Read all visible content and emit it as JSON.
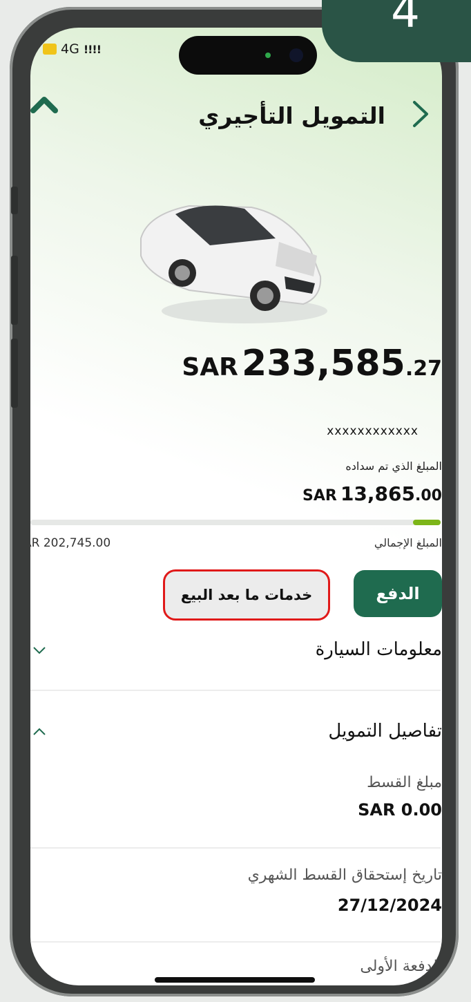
{
  "status_bar": {
    "network": "4G",
    "signal": "!!!!"
  },
  "corner_badge": {
    "step": "4"
  },
  "header": {
    "title": "التمويل التأجيري"
  },
  "finance": {
    "total_currency": "SAR",
    "total_integer": "233,585",
    "total_decimal": ".27",
    "account_number": "xxxxxxxxxxxx",
    "paid_label": "المبلغ الذي تم سداده",
    "paid_currency": "SAR",
    "paid_integer": "13,865",
    "paid_decimal": ".00",
    "progress_fraction": 0.068,
    "total_label": "المبلغ الإجمالي",
    "total_amount": "AR 202,745.00"
  },
  "actions": {
    "pay_label": "الدفع",
    "after_sales_label": "خدمات ما بعد البيع"
  },
  "sections": {
    "car_info": {
      "title": "معلومات السيارة"
    },
    "finance_details": {
      "title": "تفاصيل التمويل"
    }
  },
  "details": [
    {
      "label": "مبلغ القسط",
      "value": "SAR 0.00"
    },
    {
      "label": "تاريخ إستحقاق القسط الشهري",
      "value": "27/12/2024"
    },
    {
      "label": "الدفعة الأولى",
      "value": ""
    }
  ],
  "colors": {
    "primary": "#1f6b4f",
    "progress": "#7cb518",
    "highlight": "#e01919",
    "badge": "#2a5446"
  }
}
